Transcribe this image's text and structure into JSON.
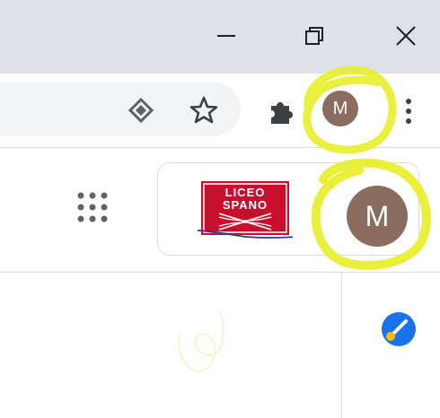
{
  "window_controls": {
    "minimize_icon": "minimize-icon",
    "restore_icon": "restore-icon",
    "close_icon": "close-icon"
  },
  "toolbar": {
    "lens_icon": "google-lens-icon",
    "bookmark_icon": "star-icon",
    "extensions_icon": "puzzle-icon",
    "menu_icon": "kebab-menu-icon",
    "profile_initial": "M"
  },
  "google_header": {
    "apps_icon": "apps-grid-icon",
    "logo": {
      "line1": "LICEO",
      "line2": "SPANO"
    },
    "account_initial": "M"
  },
  "side_panel": {
    "tasks_icon": "tasks-icon"
  },
  "colors": {
    "titlebar": "#dee1e6",
    "omnibox": "#f1f3f4",
    "avatar": "#8b6d5f",
    "highlight": "#e8ee2a",
    "logo_red": "#c8102e",
    "tasks_blue": "#1a73e8",
    "tasks_yellow": "#fbbc04"
  }
}
